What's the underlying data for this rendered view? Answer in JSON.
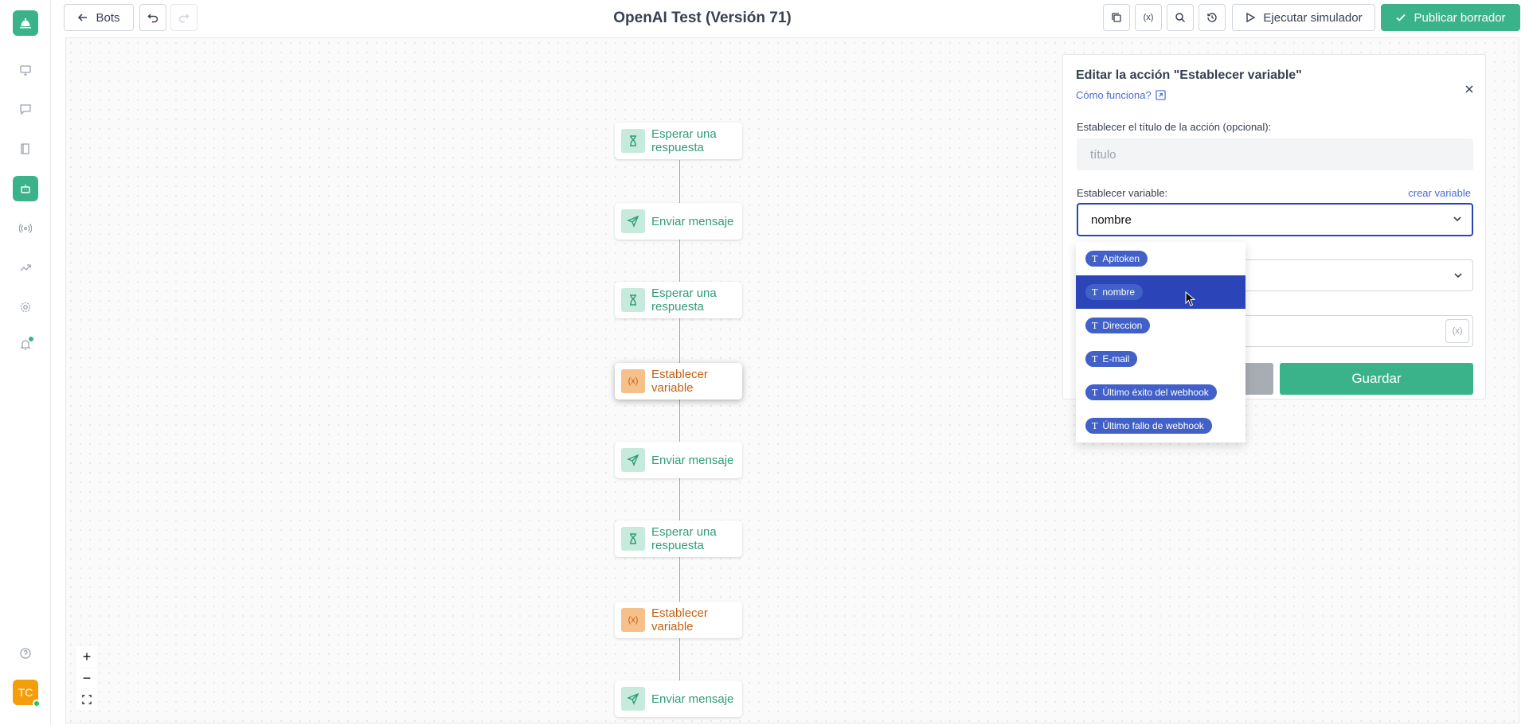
{
  "topbar": {
    "back_label": "Bots",
    "title": "OpenAI Test (Versión 71)",
    "simulate_label": "Ejecutar simulador",
    "publish_label": "Publicar borrador"
  },
  "user": {
    "initials": "TC"
  },
  "flow": {
    "nodes": [
      {
        "label": "Esperar una respuesta",
        "type": "wait"
      },
      {
        "label": "Enviar mensaje",
        "type": "send"
      },
      {
        "label": "Esperar una respuesta",
        "type": "wait"
      },
      {
        "label": "Establecer variable",
        "type": "variable",
        "selected": true
      },
      {
        "label": "Enviar mensaje",
        "type": "send"
      },
      {
        "label": "Esperar una respuesta",
        "type": "wait"
      },
      {
        "label": "Establecer variable",
        "type": "variable"
      },
      {
        "label": "Enviar mensaje",
        "type": "send"
      }
    ]
  },
  "zoom": {
    "in": "+",
    "out": "−"
  },
  "panel": {
    "title": "Editar la acción \"Establecer variable\"",
    "help_link": "Cómo funciona?",
    "title_label": "Establecer el título de la acción (opcional):",
    "title_placeholder": "título",
    "variable_label": "Establecer variable:",
    "create_variable": "crear variable",
    "variable_value": "nombre",
    "var_button": "(x)",
    "save_label": "Guardar"
  },
  "dropdown": {
    "options": [
      "Apitoken",
      "nombre",
      "Direccion",
      "E-mail",
      "Último éxito del webhook",
      "Último fallo de webhook"
    ],
    "highlighted_index": 1
  },
  "colors": {
    "brand": "#3bb38a",
    "accent_blue": "#2b45b8",
    "chip_blue": "#4160c8",
    "node_orange": "#c25f10"
  }
}
